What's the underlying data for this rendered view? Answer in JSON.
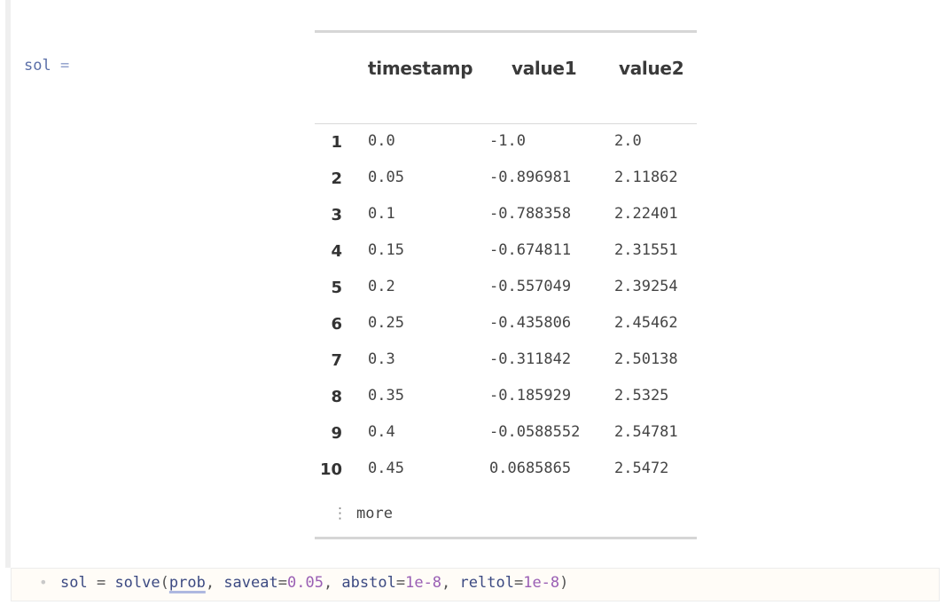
{
  "cell_output": {
    "variable": "sol",
    "equals": "=",
    "table": {
      "columns": [
        "timestamp",
        "value1",
        "value2"
      ],
      "rows": [
        {
          "index": "1",
          "timestamp": "0.0",
          "value1": "-1.0",
          "value2": "2.0"
        },
        {
          "index": "2",
          "timestamp": "0.05",
          "value1": "-0.896981",
          "value2": "2.11862"
        },
        {
          "index": "3",
          "timestamp": "0.1",
          "value1": "-0.788358",
          "value2": "2.22401"
        },
        {
          "index": "4",
          "timestamp": "0.15",
          "value1": "-0.674811",
          "value2": "2.31551"
        },
        {
          "index": "5",
          "timestamp": "0.2",
          "value1": "-0.557049",
          "value2": "2.39254"
        },
        {
          "index": "6",
          "timestamp": "0.25",
          "value1": "-0.435806",
          "value2": "2.45462"
        },
        {
          "index": "7",
          "timestamp": "0.3",
          "value1": "-0.311842",
          "value2": "2.50138"
        },
        {
          "index": "8",
          "timestamp": "0.35",
          "value1": "-0.185929",
          "value2": "2.5325"
        },
        {
          "index": "9",
          "timestamp": "0.4",
          "value1": "-0.0588552",
          "value2": "2.54781"
        },
        {
          "index": "10",
          "timestamp": "0.45",
          "value1": "0.0685865",
          "value2": "2.5472"
        }
      ],
      "more_icon": "vertical-ellipsis-icon",
      "more_glyph": "⋮",
      "more_label": "more"
    }
  },
  "code_cell": {
    "bullet": "•",
    "tokens": {
      "sol": "sol",
      "eq": " = ",
      "fn": "solve",
      "open": "(",
      "arg1": "prob",
      "sep1": ", ",
      "kw1": "saveat",
      "eq1": "=",
      "val1": "0.05",
      "sep2": ", ",
      "kw2": "abstol",
      "eq2": "=",
      "val2": "1e-8",
      "sep3": ", ",
      "kw3": "reltol",
      "eq3": "=",
      "val3": "1e-8",
      "close": ")"
    }
  }
}
